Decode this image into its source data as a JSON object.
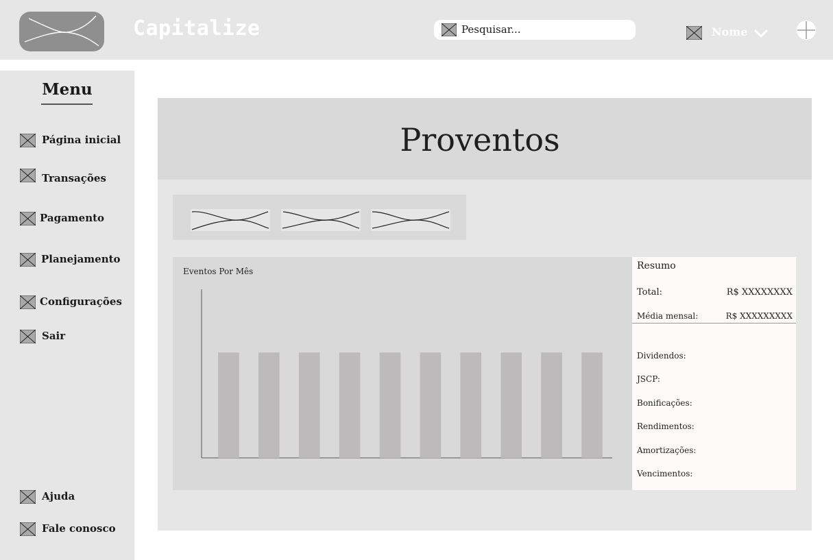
{
  "header": {
    "app_title": "Capitalize",
    "search_placeholder": "Pesquisar...",
    "user_name": "Nome"
  },
  "sidebar": {
    "menu_title": "Menu",
    "items": [
      {
        "label": "Página inicial",
        "icon": "image-placeholder-icon"
      },
      {
        "label": "Transações",
        "icon": "image-placeholder-icon"
      },
      {
        "label": "Pagamento",
        "icon": "image-placeholder-icon"
      },
      {
        "label": "Planejamento",
        "icon": "image-placeholder-icon"
      },
      {
        "label": "Configurações",
        "icon": "image-placeholder-icon"
      },
      {
        "label": "Sair",
        "icon": "image-placeholder-icon"
      }
    ],
    "footer_items": [
      {
        "label": "Ajuda",
        "icon": "image-placeholder-icon"
      },
      {
        "label": "Fale conosco",
        "icon": "image-placeholder-icon"
      }
    ]
  },
  "main": {
    "title": "Proventos",
    "filters": [
      "filter-placeholder-1",
      "filter-placeholder-2",
      "filter-placeholder-3"
    ]
  },
  "summary": {
    "title": "Resumo",
    "total_label": "Total:",
    "total_value": "R$ XXXXXXXX",
    "average_label": "Média mensal:",
    "average_value": "R$ XXXXXXXXX",
    "categories": [
      "Dividendos:",
      "JSCP:",
      "Bonificações:",
      "Rendimentos:",
      "Amortizações:",
      "Vencimentos:"
    ]
  },
  "colors": {
    "header_bg": "#e6e6e6",
    "panel_bg": "#d9d9d9",
    "bar_fill": "#bcbaba",
    "summary_bg": "#fffafa"
  },
  "chart_data": {
    "type": "bar",
    "title": "Eventos Por Mês",
    "categories": [
      "",
      "",
      "",
      "",
      "",
      "",
      "",
      "",
      "",
      ""
    ],
    "values": [
      1,
      1,
      1,
      1,
      1,
      1,
      1,
      1,
      1,
      1
    ],
    "ylim": [
      0,
      1.6
    ],
    "xlabel": "",
    "ylabel": "",
    "grid": false
  }
}
